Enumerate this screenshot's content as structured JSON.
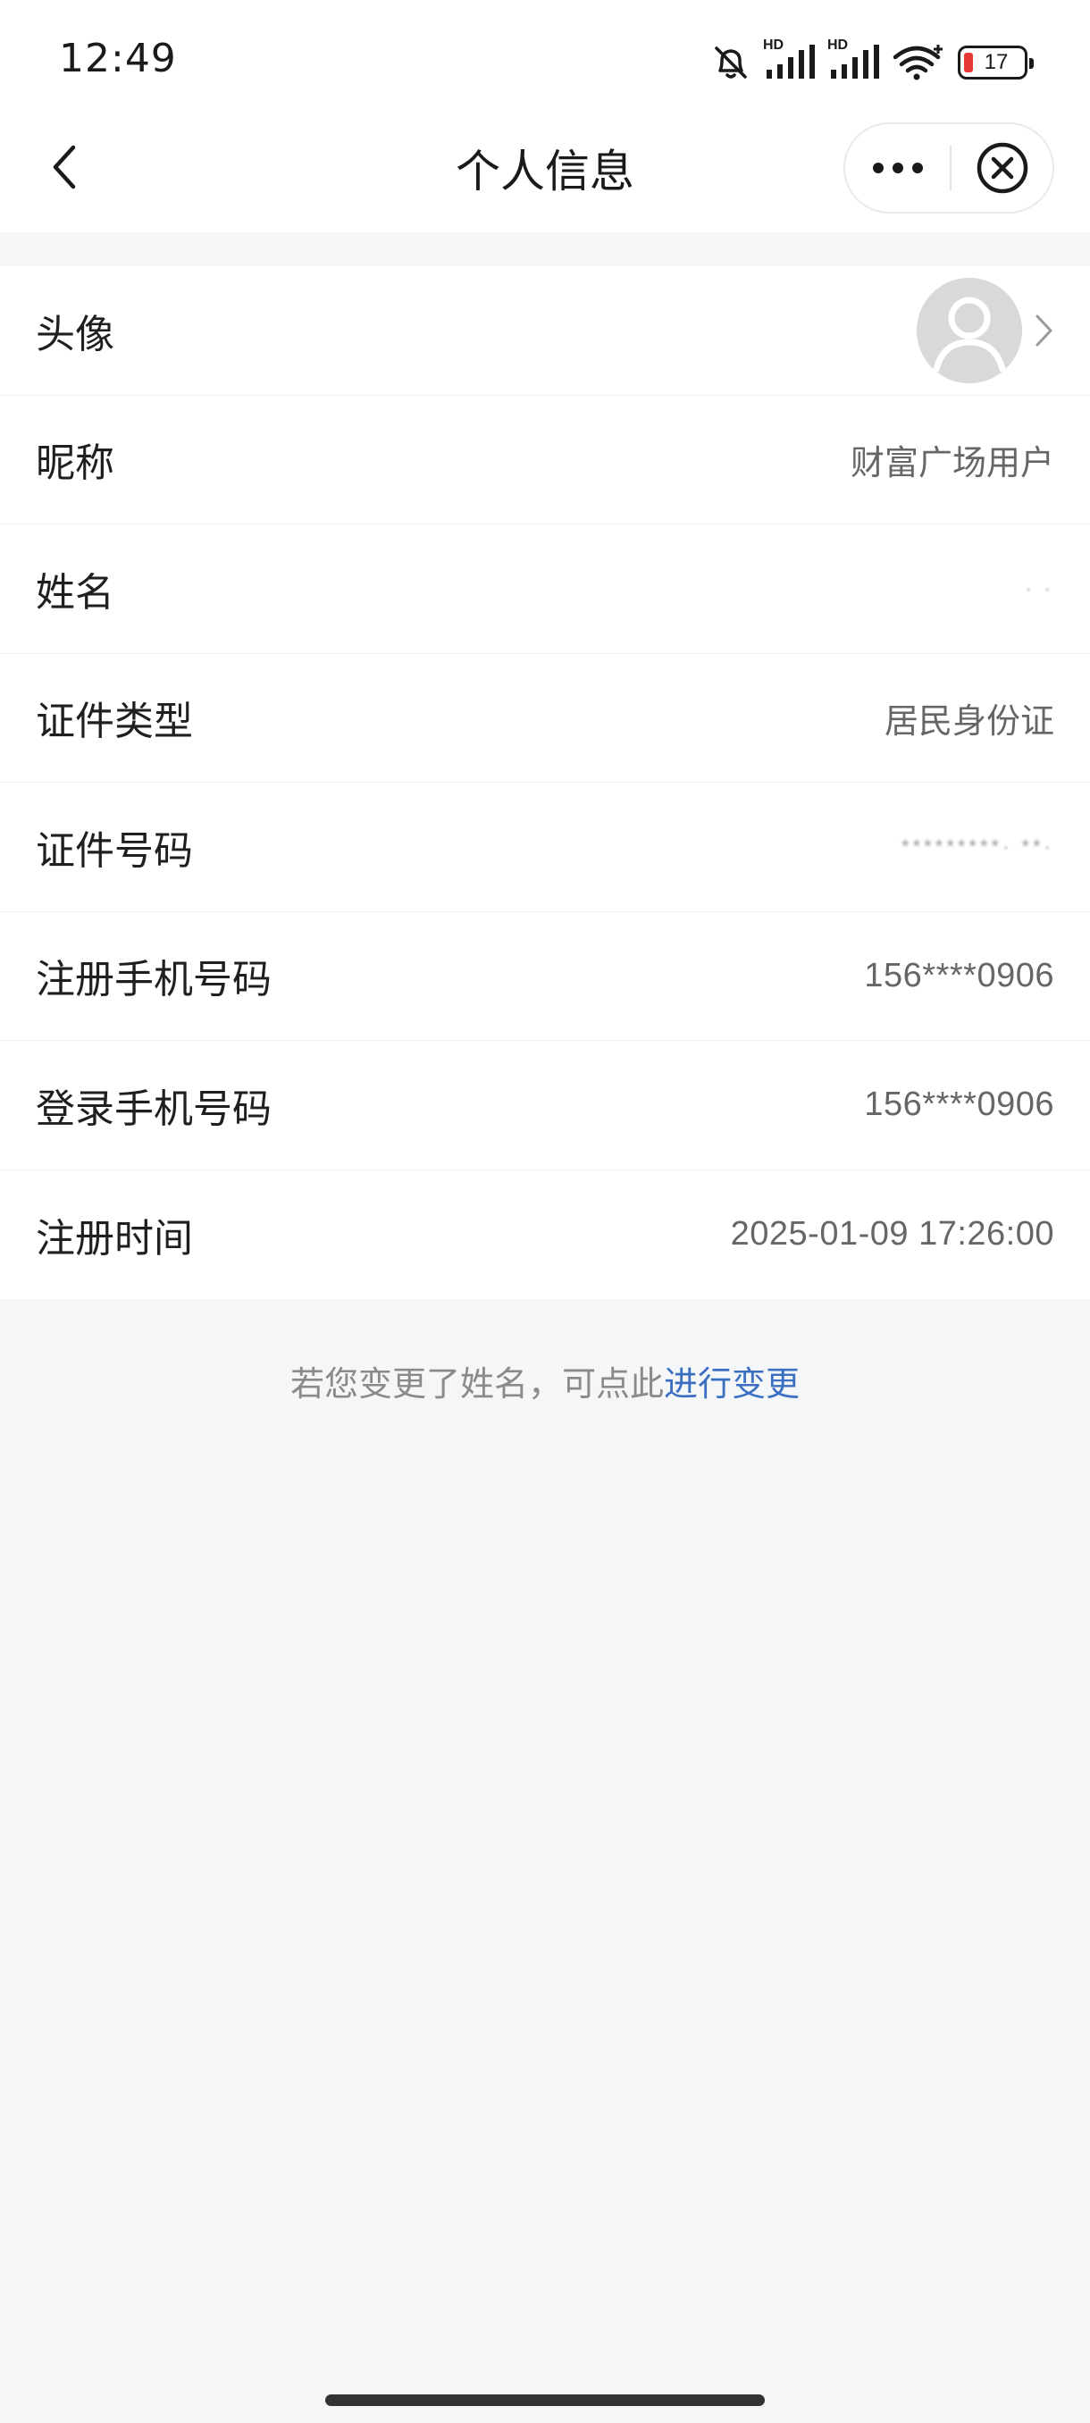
{
  "status_bar": {
    "time": "12:49",
    "network_1": "HD",
    "network_2": "HD",
    "battery_level": "17",
    "icons": [
      "bell-mute-icon",
      "signal-icon",
      "signal-icon",
      "wifi-icon",
      "battery-icon"
    ]
  },
  "nav": {
    "title": "个人信息",
    "back_icon": "chevron-left-icon",
    "more_icon": "more-dots-icon",
    "close_icon": "close-circle-icon"
  },
  "rows": [
    {
      "label": "头像",
      "value": "",
      "type": "avatar"
    },
    {
      "label": "昵称",
      "value": "财富广场用户"
    },
    {
      "label": "姓名",
      "value": "·  ·"
    },
    {
      "label": "证件类型",
      "value": "居民身份证"
    },
    {
      "label": "证件号码",
      "value": "*********·   **·"
    },
    {
      "label": "注册手机号码",
      "value": "156****0906"
    },
    {
      "label": "登录手机号码",
      "value": "156****0906"
    },
    {
      "label": "注册时间",
      "value": "2025-01-09 17:26:00"
    }
  ],
  "note": {
    "text": "若您变更了姓名，可点此",
    "link": "进行变更"
  },
  "colors": {
    "link": "#3b6fc2",
    "background": "#f5f6f8",
    "battery_low": "#e53935"
  }
}
